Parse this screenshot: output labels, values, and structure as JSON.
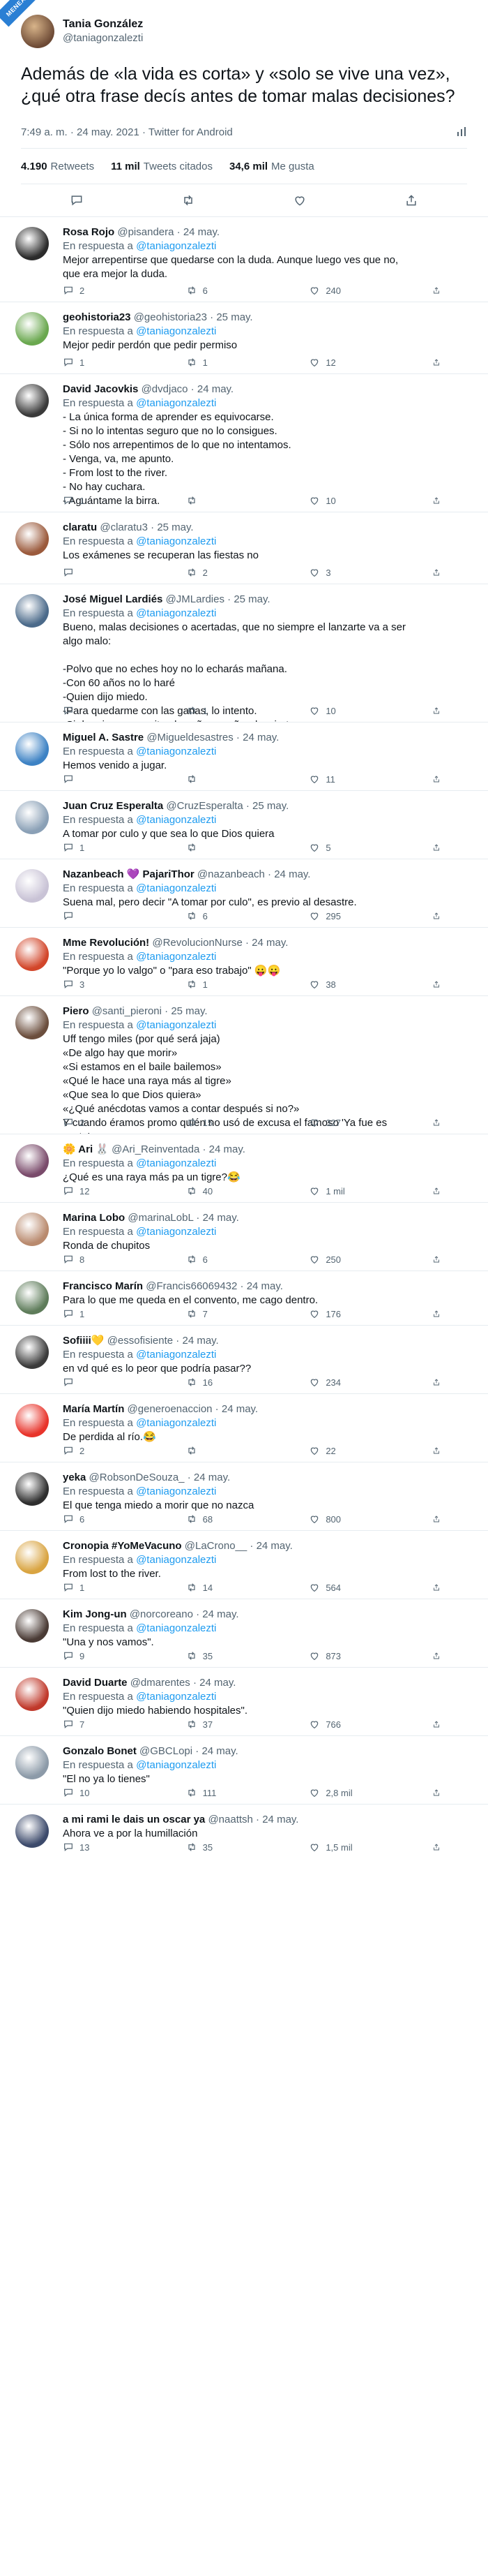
{
  "badge": "MENEAME",
  "main": {
    "author_name": "Tania González",
    "author_handle": "@taniagonzalezti",
    "text": "Además de «la vida es corta» y «solo se vive una vez», ¿qué otra frase decís antes de tomar malas decisiones?",
    "meta": "7:49 a. m. · 24 may. 2021 · Twitter for Android",
    "retweets": "4.190",
    "retweets_label": "Retweets",
    "quotes": "11 mil",
    "quotes_label": "Tweets citados",
    "likes": "34,6 mil",
    "likes_label": "Me gusta"
  },
  "replying_prefix": "En respuesta a",
  "replies": [
    {
      "name": "Rosa Rojo",
      "handle": "@pisandera",
      "date": "24 may.",
      "mention": "@taniagonzalezti",
      "text": "Mejor arrepentirse que quedarse con la duda. Aunque luego ves que no,\nque era mejor la duda.",
      "replies": "2",
      "retweets": "6",
      "likes": "240",
      "color": "#2b2b2b"
    },
    {
      "name": "geohistoria23",
      "handle": "@geohistoria23",
      "date": "25 may.",
      "mention": "@taniagonzalezti",
      "text": "Mejor pedir perdón que pedir permiso",
      "replies": "1",
      "retweets": "1",
      "likes": "12",
      "color": "#6aa84f"
    },
    {
      "name": "David Jacovkis",
      "handle": "@dvdjaco",
      "date": "24 may.",
      "mention": "@taniagonzalezti",
      "text": "- La única forma de aprender es equivocarse.\n- Si no lo intentas seguro que no lo consigues.\n- Sólo nos arrepentimos de lo que no intentamos.\n- Venga, va, me apunto.\n- From lost to the river.\n- No hay cuchara.\n- Aguántame la birra.",
      "replies": "1",
      "retweets": "",
      "likes": "10",
      "color": "#3a3a3a"
    },
    {
      "name": "claratu",
      "handle": "@claratu3",
      "date": "25 may.",
      "mention": "@taniagonzalezti",
      "text": "Los exámenes se recuperan las fiestas no",
      "replies": "",
      "retweets": "2",
      "likes": "3",
      "color": "#9b5a3c"
    },
    {
      "name": "José Miguel Lardiés",
      "handle": "@JMLardies",
      "date": "25 may.",
      "mention": "@taniagonzalezti",
      "text": "Bueno, malas decisiones o acertadas, que no siempre el lanzarte va a ser\nalgo malo:\n\n-Polvo que no eches hoy no lo echarás mañana.\n-Con 60 años no lo haré\n-Quien dijo miedo.\n-Para quedarme con las ganas, lo intento.\n-Si dormir no me quita el sueño, a soñar despierto.",
      "replies": "",
      "retweets": "1",
      "likes": "10",
      "color": "#4b6a8a"
    },
    {
      "name": "Miguel A. Sastre",
      "handle": "@Migueldesastres",
      "date": "24 may.",
      "mention": "@taniagonzalezti",
      "text": "Hemos venido a jugar.",
      "replies": "",
      "retweets": "",
      "likes": "11",
      "color": "#3d82c4"
    },
    {
      "name": "Juan Cruz Esperalta",
      "handle": "@CruzEsperalta",
      "date": "25 may.",
      "mention": "@taniagonzalezti",
      "text": "A tomar por culo y que sea lo que Dios quiera",
      "replies": "1",
      "retweets": "",
      "likes": "5",
      "color": "#8aa0b6"
    },
    {
      "name": "Nazanbeach 💜 PajariThor",
      "handle": "@nazanbeach",
      "date": "24 may.",
      "mention": "@taniagonzalezti",
      "text": "Suena mal, pero decir \"A tomar por culo\", es previo al desastre.",
      "replies": "",
      "retweets": "6",
      "likes": "295",
      "color": "#c9c3d6"
    },
    {
      "name": "Mme Revolución!",
      "handle": "@RevolucionNurse",
      "date": "24 may.",
      "mention": "@taniagonzalezti",
      "text": "\"Porque yo lo valgo\" o \"para eso trabajo\" 😛😛",
      "replies": "3",
      "retweets": "1",
      "likes": "38",
      "color": "#d2462a"
    },
    {
      "name": "Piero",
      "handle": "@santi_pieroni",
      "date": "25 may.",
      "mention": "@taniagonzalezti",
      "text": "Uff tengo miles (por qué será jaja)\n«De algo hay que morir»\n«Si estamos en el baile bailemos»\n«Qué le hace una raya más al tigre»\n«Que sea lo que Dios quiera»\n«¿Qué anécdotas vamos a contar después si no?»\nY cuando éramos promo quién no usó de excusa el famoso 'Ya fue es\nsexto'",
      "replies": "2",
      "retweets": "15",
      "likes": "327",
      "color": "#6b4e3d"
    },
    {
      "name": "🌼 Ari 🐰",
      "handle": "@Ari_Reinventada",
      "date": "24 may.",
      "mention": "@taniagonzalezti",
      "text": "¿Qué es una raya más pa un tigre?😂",
      "replies": "12",
      "retweets": "40",
      "likes": "1 mil",
      "color": "#7a4b6b"
    },
    {
      "name": "Marina Lobo",
      "handle": "@marinaLobL",
      "date": "24 may.",
      "mention": "@taniagonzalezti",
      "text": "Ronda de chupitos",
      "replies": "8",
      "retweets": "6",
      "likes": "250",
      "color": "#b98a6e"
    },
    {
      "name": "Francisco Marín",
      "handle": "@Francis66069432",
      "date": "24 may.",
      "mention": "",
      "text": "Para lo que me queda en el convento, me cago dentro.",
      "replies": "1",
      "retweets": "7",
      "likes": "176",
      "color": "#5e7c5a"
    },
    {
      "name": "Sofiiii💛",
      "handle": "@essofisiente",
      "date": "24 may.",
      "mention": "@taniagonzalezti",
      "text": "en vd qué es lo peor que podría pasar??",
      "replies": "",
      "retweets": "16",
      "likes": "234",
      "color": "#3b3b3b"
    },
    {
      "name": "María Martín",
      "handle": "@generoenaccion",
      "date": "24 may.",
      "mention": "@taniagonzalezti",
      "text": "De perdida al río.😂",
      "replies": "2",
      "retweets": "",
      "likes": "22",
      "color": "#e8342b"
    },
    {
      "name": "yeka",
      "handle": "@RobsonDeSouza_",
      "date": "24 may.",
      "mention": "@taniagonzalezti",
      "text": "El que tenga miedo a morir que no nazca",
      "replies": "6",
      "retweets": "68",
      "likes": "800",
      "color": "#2e2e2e"
    },
    {
      "name": "Cronopia #YoMeVacuno",
      "handle": "@LaCrono__",
      "date": "24 may.",
      "mention": "@taniagonzalezti",
      "text": "From lost to the river.",
      "replies": "1",
      "retweets": "14",
      "likes": "564",
      "color": "#d9a441"
    },
    {
      "name": "Kim Jong-un",
      "handle": "@norcoreano",
      "date": "24 may.",
      "mention": "@taniagonzalezti",
      "text": "\"Una y nos vamos\".",
      "replies": "9",
      "retweets": "35",
      "likes": "873",
      "color": "#4a3b35"
    },
    {
      "name": "David Duarte",
      "handle": "@dmarentes",
      "date": "24 may.",
      "mention": "@taniagonzalezti",
      "text": "\"Quien dijo miedo habiendo hospitales\".",
      "replies": "7",
      "retweets": "37",
      "likes": "766",
      "color": "#c0392b"
    },
    {
      "name": "Gonzalo Bonet",
      "handle": "@GBCLopi",
      "date": "24 may.",
      "mention": "@taniagonzalezti",
      "text": "\"El no ya lo tienes\"",
      "replies": "10",
      "retweets": "111",
      "likes": "2,8 mil",
      "color": "#8c9aa8"
    },
    {
      "name": "a mi rami le dais un oscar ya",
      "handle": "@naattsh",
      "date": "24 may.",
      "mention": "",
      "text": "Ahora ve a por la humillación",
      "replies": "13",
      "retweets": "35",
      "likes": "1,5 mil",
      "color": "#3c4a6b"
    }
  ]
}
